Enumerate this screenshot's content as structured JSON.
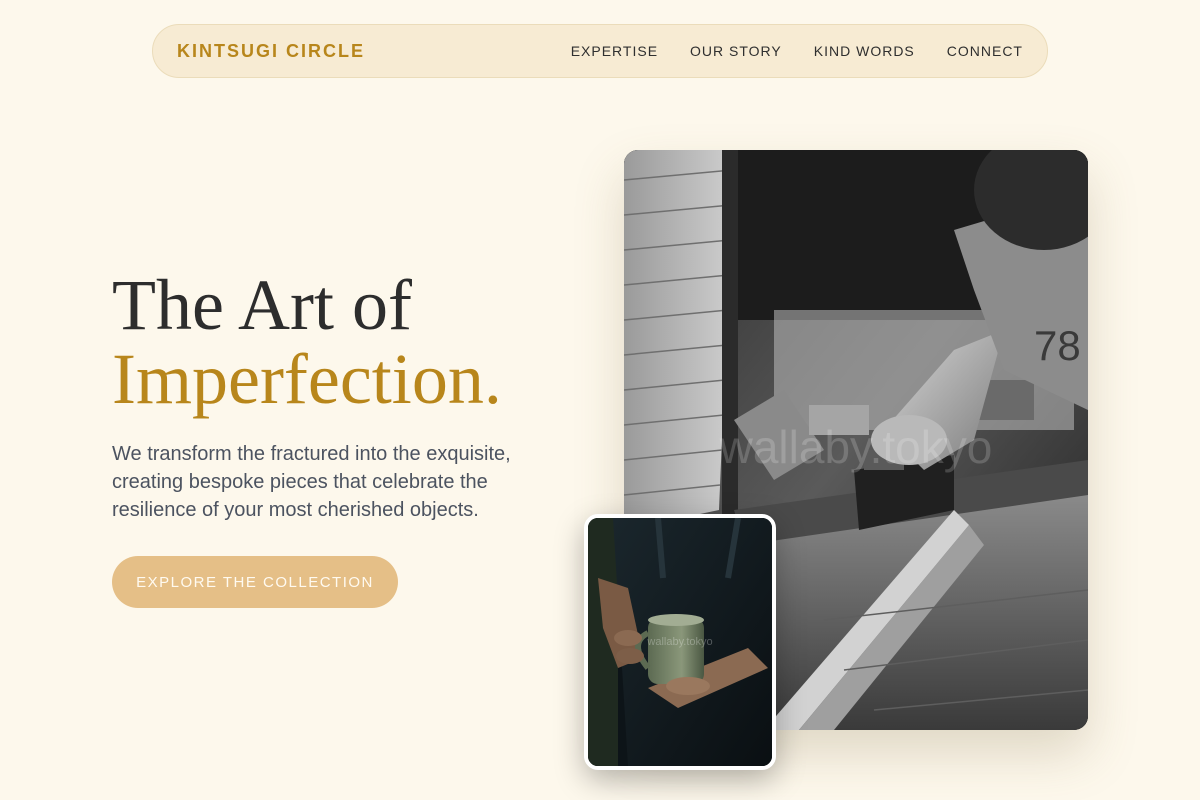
{
  "nav": {
    "brand": "KINTSUGI CIRCLE",
    "links": [
      "EXPERTISE",
      "OUR STORY",
      "KIND WORDS",
      "CONNECT"
    ]
  },
  "hero": {
    "title_line1": "The Art of",
    "title_line2": "Imperfection.",
    "description": "We transform the fractured into the exquisite, creating bespoke pieces that celebrate the resilience of your most cherished objects.",
    "cta_label": "EXPLORE THE COLLECTION"
  },
  "images": {
    "main_watermark": "wallaby.tokyo",
    "small_watermark": "wallaby.tokyo"
  },
  "colors": {
    "background": "#fdf8ec",
    "accent_gold": "#b8861b",
    "cta_bg": "#e5bf87",
    "nav_bg": "#f7ebd3",
    "body_text": "#4c5360"
  }
}
